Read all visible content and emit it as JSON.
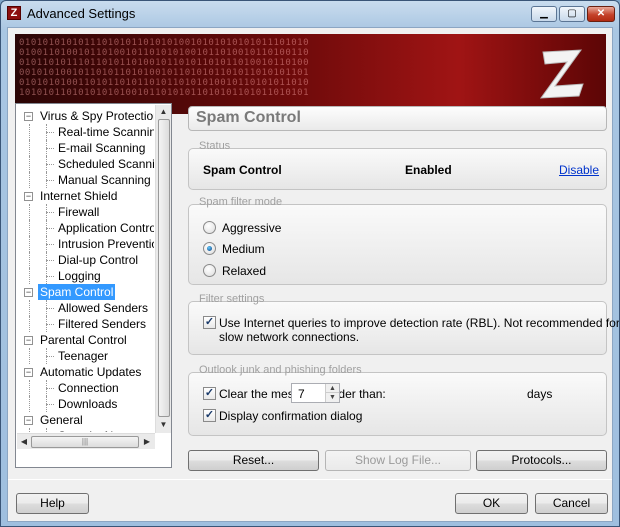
{
  "window": {
    "title": "Advanced Settings"
  },
  "banner": {
    "binary_lines": [
      "0101010101011101010110101010010101010101011101010",
      "0100110100101101001011010101001011010010110100110",
      "0101101011101101011010010110101101011010010110100",
      "0010101001011010110101001011010101101011010101101",
      "0101010100110101101011010110101010010110101011010",
      "1010101101010101010010110101011010101101011010101"
    ]
  },
  "tree": {
    "items": [
      {
        "label": "Virus & Spy Protection",
        "level": 0,
        "expander": "−"
      },
      {
        "label": "Real-time Scanning",
        "level": 1
      },
      {
        "label": "E-mail Scanning",
        "level": 1
      },
      {
        "label": "Scheduled Scanning",
        "level": 1
      },
      {
        "label": "Manual Scanning",
        "level": 1
      },
      {
        "label": "Internet Shield",
        "level": 0,
        "expander": "−"
      },
      {
        "label": "Firewall",
        "level": 1
      },
      {
        "label": "Application Control",
        "level": 1
      },
      {
        "label": "Intrusion Prevention",
        "level": 1
      },
      {
        "label": "Dial-up Control",
        "level": 1
      },
      {
        "label": "Logging",
        "level": 1
      },
      {
        "label": "Spam Control",
        "level": 0,
        "expander": "−",
        "selected": true
      },
      {
        "label": "Allowed Senders",
        "level": 1
      },
      {
        "label": "Filtered Senders",
        "level": 1
      },
      {
        "label": "Parental Control",
        "level": 0,
        "expander": "−"
      },
      {
        "label": "Teenager",
        "level": 1
      },
      {
        "label": "Automatic Updates",
        "level": 0,
        "expander": "−"
      },
      {
        "label": "Connection",
        "level": 1
      },
      {
        "label": "Downloads",
        "level": 1
      },
      {
        "label": "General",
        "level": 0,
        "expander": "−"
      },
      {
        "label": "Security News",
        "level": 1
      }
    ]
  },
  "page": {
    "title": "Spam Control"
  },
  "status": {
    "legend": "Status",
    "name": "Spam Control",
    "state": "Enabled",
    "action": "Disable"
  },
  "filter_mode": {
    "legend": "Spam filter mode",
    "options": [
      {
        "label": "Aggressive",
        "selected": false
      },
      {
        "label": "Medium",
        "selected": true
      },
      {
        "label": "Relaxed",
        "selected": false
      }
    ]
  },
  "filter_settings": {
    "legend": "Filter settings",
    "rbl_checked": true,
    "rbl_line1": "Use Internet queries to improve detection rate (RBL). Not recommended for",
    "rbl_line2": "slow network connections."
  },
  "outlook": {
    "legend": "Outlook junk and phishing folders",
    "clear_checked": true,
    "clear_label": "Clear the messages older than:",
    "days_value": "7",
    "days_unit": "days",
    "confirm_checked": true,
    "confirm_label": "Display confirmation dialog"
  },
  "actions": {
    "reset": "Reset...",
    "show_log": "Show Log File...",
    "protocols": "Protocols..."
  },
  "footer": {
    "help": "Help",
    "ok": "OK",
    "cancel": "Cancel"
  }
}
